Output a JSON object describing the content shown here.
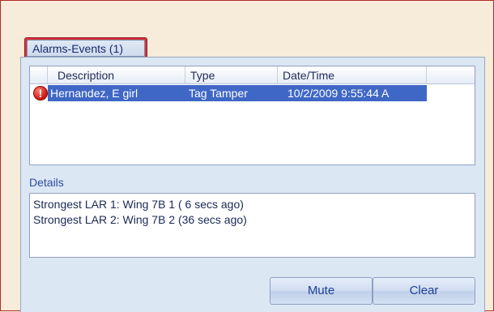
{
  "tab": {
    "label": "Alarms-Events (1)"
  },
  "list": {
    "columns": [
      "Description",
      "Type",
      "Date/Time"
    ],
    "rows": [
      {
        "description": "Hernandez, E girl",
        "type": "Tag Tamper",
        "datetime": "10/2/2009 9:55:44 A",
        "icon": "alert-icon",
        "selected": true
      }
    ]
  },
  "details": {
    "label": "Details",
    "lines": [
      "Strongest LAR 1: Wing 7B 1 ( 6 secs ago)",
      "Strongest LAR 2: Wing 7B 2 (36 secs ago)"
    ]
  },
  "buttons": {
    "mute": "Mute",
    "clear": "Clear"
  },
  "colors": {
    "background": "#f7ecd9",
    "frame_border": "#b22a2a",
    "tab_red": "#d9333a",
    "panel": "#dce7f4",
    "selection": "#3f67c6"
  }
}
